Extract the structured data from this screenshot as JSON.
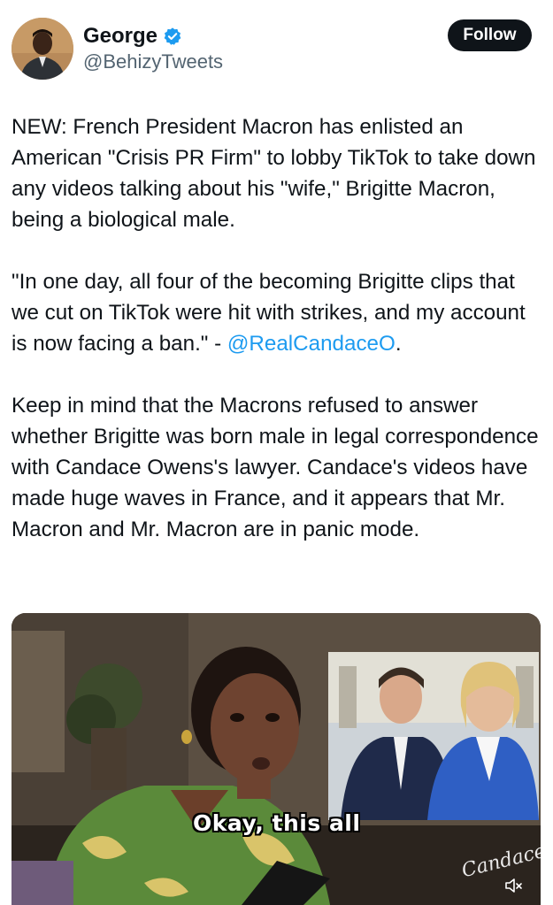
{
  "author": {
    "display_name": "George",
    "handle": "@BehizyTweets",
    "verified": true,
    "verified_color": "#1d9bf0"
  },
  "follow_button": {
    "label": "Follow"
  },
  "tweet": {
    "paragraph1": "NEW: French President Macron has enlisted an American \"Crisis PR Firm\" to lobby TikTok to take down any videos talking about his \"wife,\" Brigitte Macron, being a biological male.",
    "paragraph2_text": "\"In one day, all four of the becoming Brigitte clips that we cut on TikTok were hit with strikes, and my account is now facing a ban.\" - ",
    "paragraph2_mention": "@RealCandaceO",
    "paragraph2_end": ".",
    "paragraph3": "Keep in mind that the Macrons refused to answer whether Brigitte was born male in legal correspondence with Candace Owens's lawyer. Candace's videos have made huge waves in France, and it appears that Mr. Macron and Mr. Macron are in panic mode."
  },
  "media": {
    "caption": "Okay, this all",
    "watermark": "Candace",
    "mute_icon": "speaker-muted-icon"
  },
  "colors": {
    "mention": "#1d9bf0",
    "follow_bg": "#0f1419",
    "secondary_text": "#536471"
  }
}
